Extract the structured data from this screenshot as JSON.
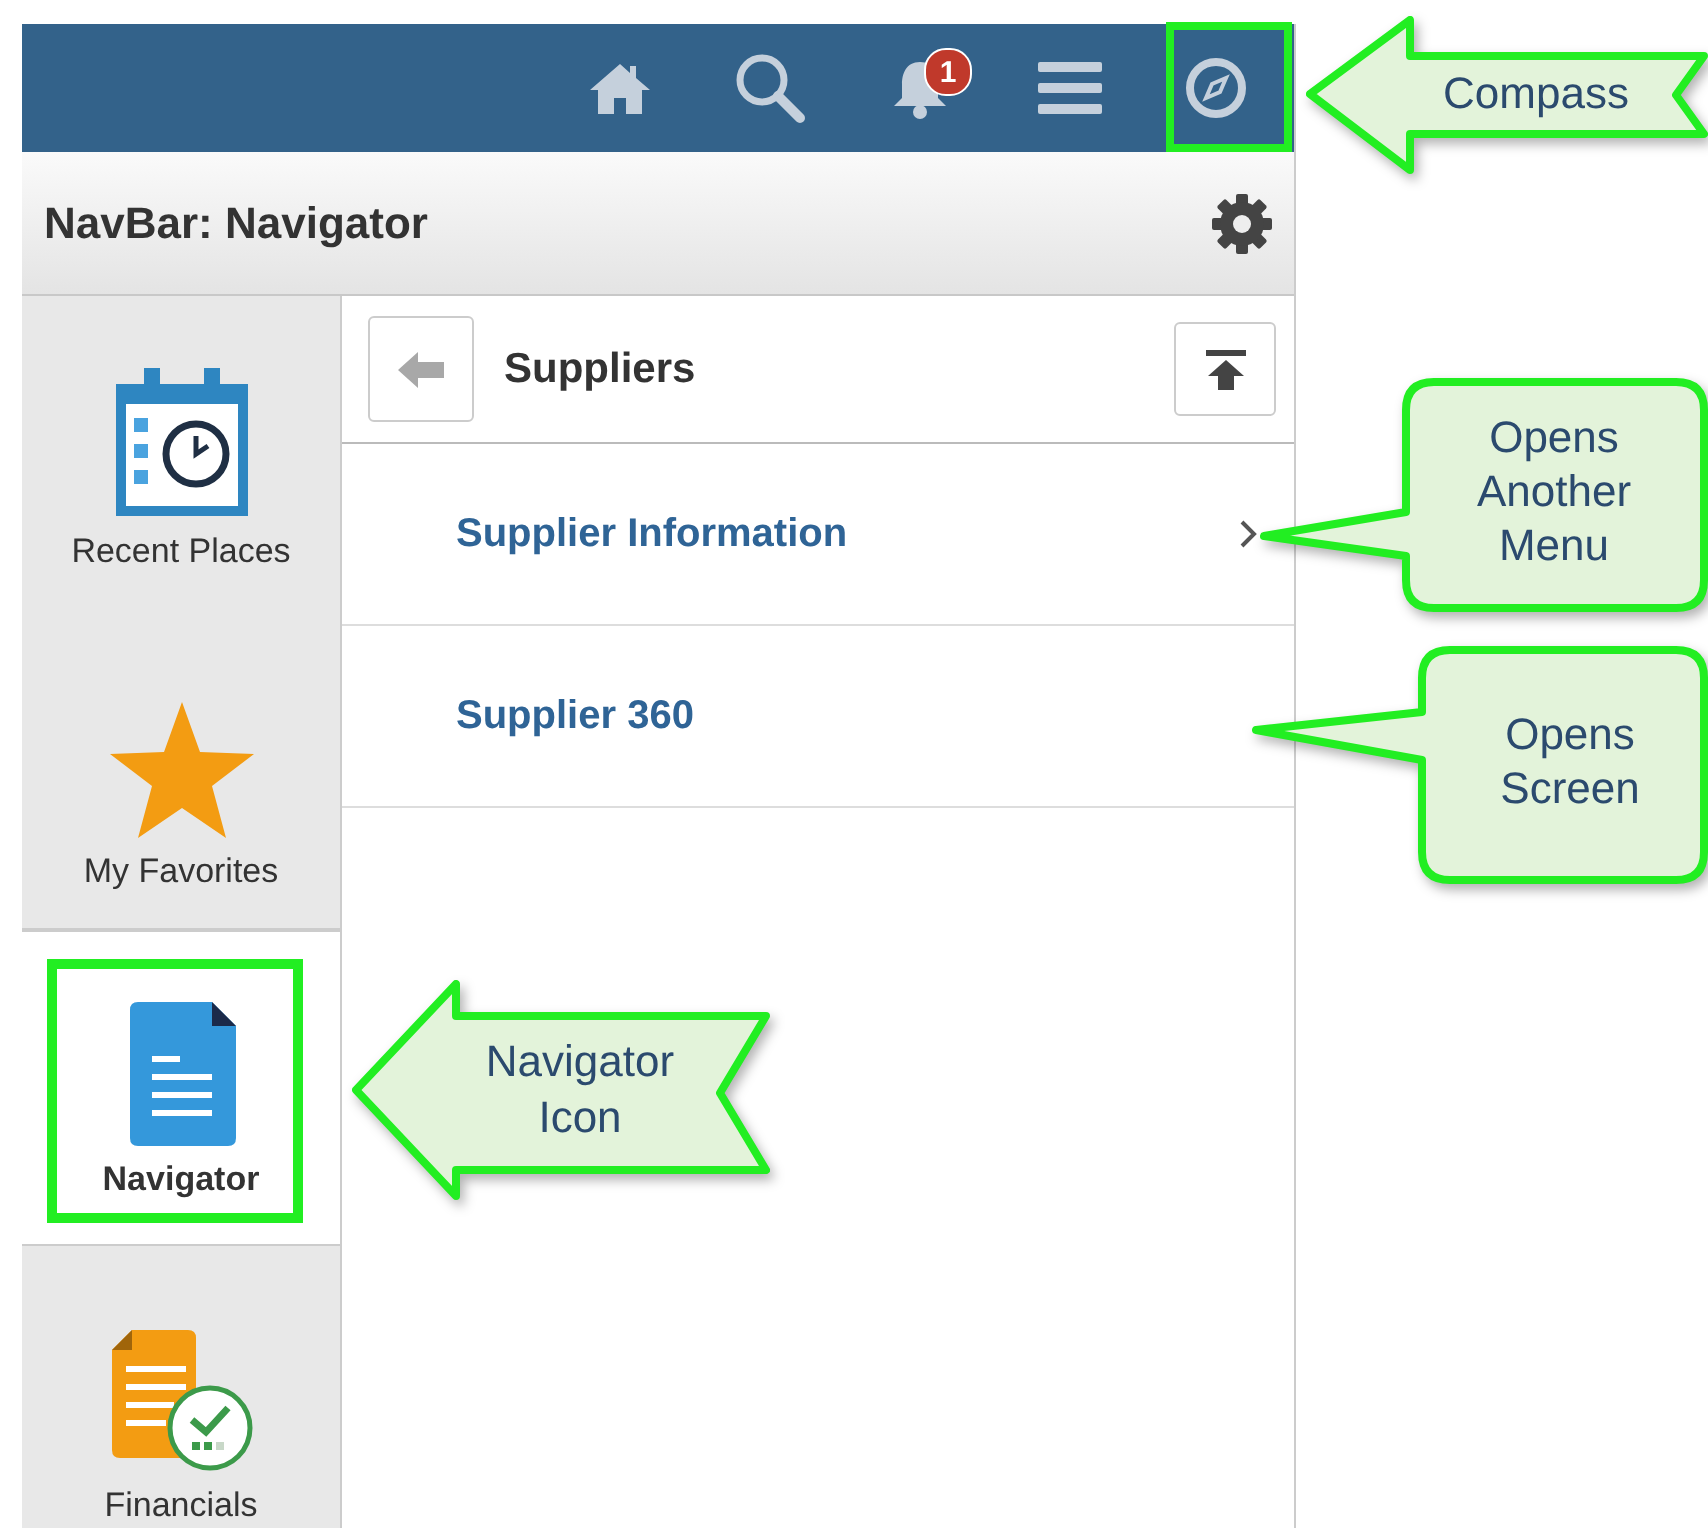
{
  "toolbar": {
    "notification_count": "1"
  },
  "title_bar": {
    "title": "NavBar: Navigator"
  },
  "sidebar": {
    "items": [
      {
        "label": "Recent Places",
        "kind": "calendar",
        "selected": false
      },
      {
        "label": "My Favorites",
        "kind": "star",
        "selected": false
      },
      {
        "label": "Navigator",
        "kind": "document",
        "selected": true
      },
      {
        "label": "Financials",
        "kind": "report",
        "selected": false
      }
    ]
  },
  "navigator": {
    "title": "Suppliers",
    "items": [
      {
        "label": "Supplier Information",
        "kind": "folder"
      },
      {
        "label": "Supplier 360",
        "kind": "link"
      }
    ]
  },
  "annotations": [
    {
      "kind": "arrow",
      "lines": [
        "Compass"
      ]
    },
    {
      "kind": "callout",
      "lines": [
        "Opens",
        "Another",
        "Menu"
      ]
    },
    {
      "kind": "callout",
      "lines": [
        "Opens",
        "Screen"
      ]
    },
    {
      "kind": "arrow",
      "lines": [
        "Navigator",
        "Icon"
      ]
    }
  ]
}
